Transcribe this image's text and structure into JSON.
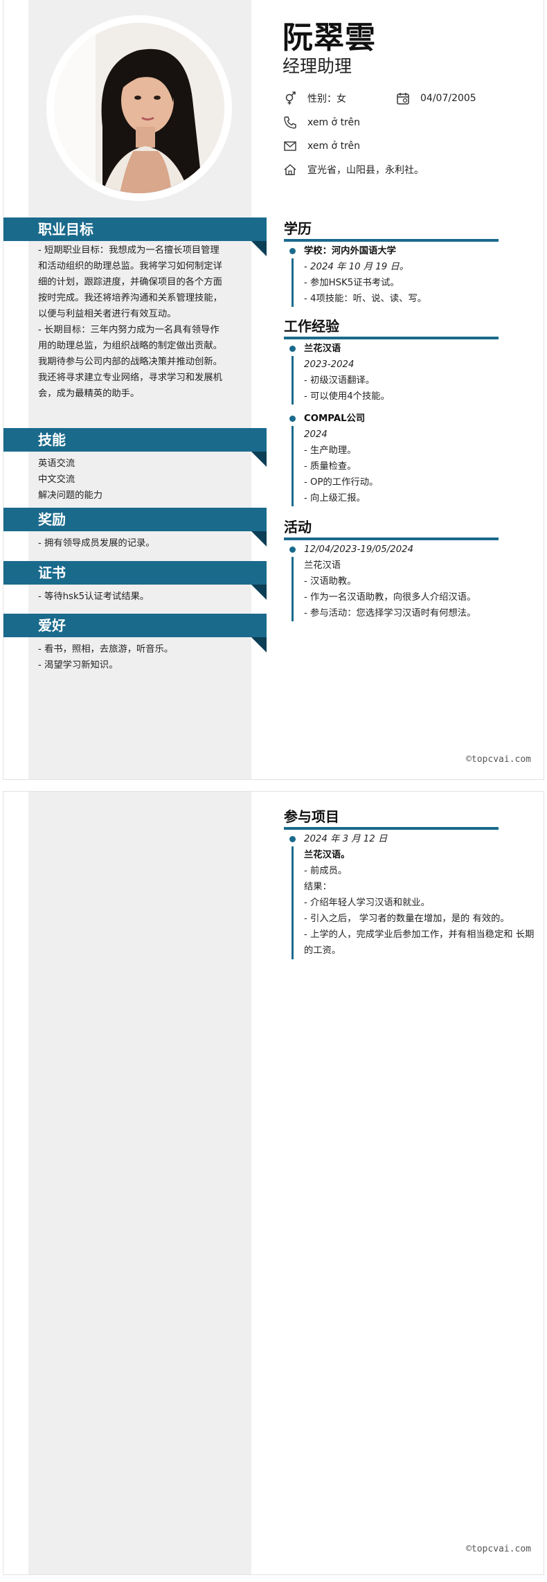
{
  "header": {
    "name": "阮翠雲",
    "job_title": "经理助理",
    "gender": "性别：女",
    "birthday": "04/07/2005",
    "phone": "xem ở trên",
    "email": "xem ở trên",
    "address": "宣光省，山阳县，永利社。"
  },
  "left": {
    "objective": {
      "title": "职业目标",
      "lines": [
        "- 短期职业目标：我想成为一名擅长项目管理和活动组织的助理总监。我将学习如何制定详细的计划，跟踪进度，并确保项目的各个方面按时完成。我还将培养沟通和关系管理技能，以便与利益相关者进行有效互动。",
        "- 长期目标：三年内努力成为一名具有领导作用的助理总监，为组织战略的制定做出贡献。我期待参与公司内部的战略决策并推动创新。我还将寻求建立专业网络，寻求学习和发展机会，成为最精英的助手。"
      ]
    },
    "skills": {
      "title": "技能",
      "lines": [
        "英语交流",
        "中文交流",
        "解决问题的能力"
      ]
    },
    "awards": {
      "title": "奖励",
      "lines": [
        "- 拥有领导成员发展的记录。"
      ]
    },
    "certificates": {
      "title": "证书",
      "lines": [
        "- 等待hsk5认证考试结果。"
      ]
    },
    "hobbies": {
      "title": "爱好",
      "lines": [
        "- 看书，照相，去旅游，听音乐。",
        "- 渴望学习新知识。"
      ]
    }
  },
  "right": {
    "education": {
      "title": "学历",
      "entries": [
        {
          "heading": "学校：河内外国语大学",
          "date": "- 2024 年 10 月 19 日。",
          "lines": [
            "- 参加HSK5证书考试。",
            "- 4项技能：听、说、读、写。"
          ]
        }
      ]
    },
    "experience": {
      "title": "工作经验",
      "entries": [
        {
          "heading": "兰花汉语",
          "date": "2023-2024",
          "lines": [
            "- 初级汉语翻译。",
            "- 可以使用4个技能。"
          ]
        },
        {
          "heading": "COMPAL公司",
          "date": "2024",
          "lines": [
            "- 生产助理。",
            "- 质量检查。",
            "- OP的工作行动。",
            "- 向上级汇报。"
          ]
        }
      ]
    },
    "activities": {
      "title": "活动",
      "entries": [
        {
          "date": "12/04/2023-19/05/2024",
          "lines": [
            "兰花汉语",
            "- 汉语助教。",
            "- 作为一名汉语助教，向很多人介绍汉语。",
            "- 参与活动：您选择学习汉语时有何想法。"
          ]
        }
      ]
    },
    "projects": {
      "title": "参与项目",
      "entries": [
        {
          "date": "2024 年 3 月 12 日",
          "heading": "兰花汉语。",
          "lines": [
            "- 前成员。",
            "结果：",
            "- 介绍年轻人学习汉语和就业。",
            "- 引入之后， 学习者的数量在增加，是的 有效的。",
            "- 上学的人，完成学业后参加工作，并有相当稳定和 长期的工资。"
          ]
        }
      ]
    }
  },
  "watermark": "©topcvai.com",
  "colors": {
    "accent": "#1a6a8c",
    "accent_dark": "#0c3e55",
    "sidebar_bg": "#efefef"
  }
}
